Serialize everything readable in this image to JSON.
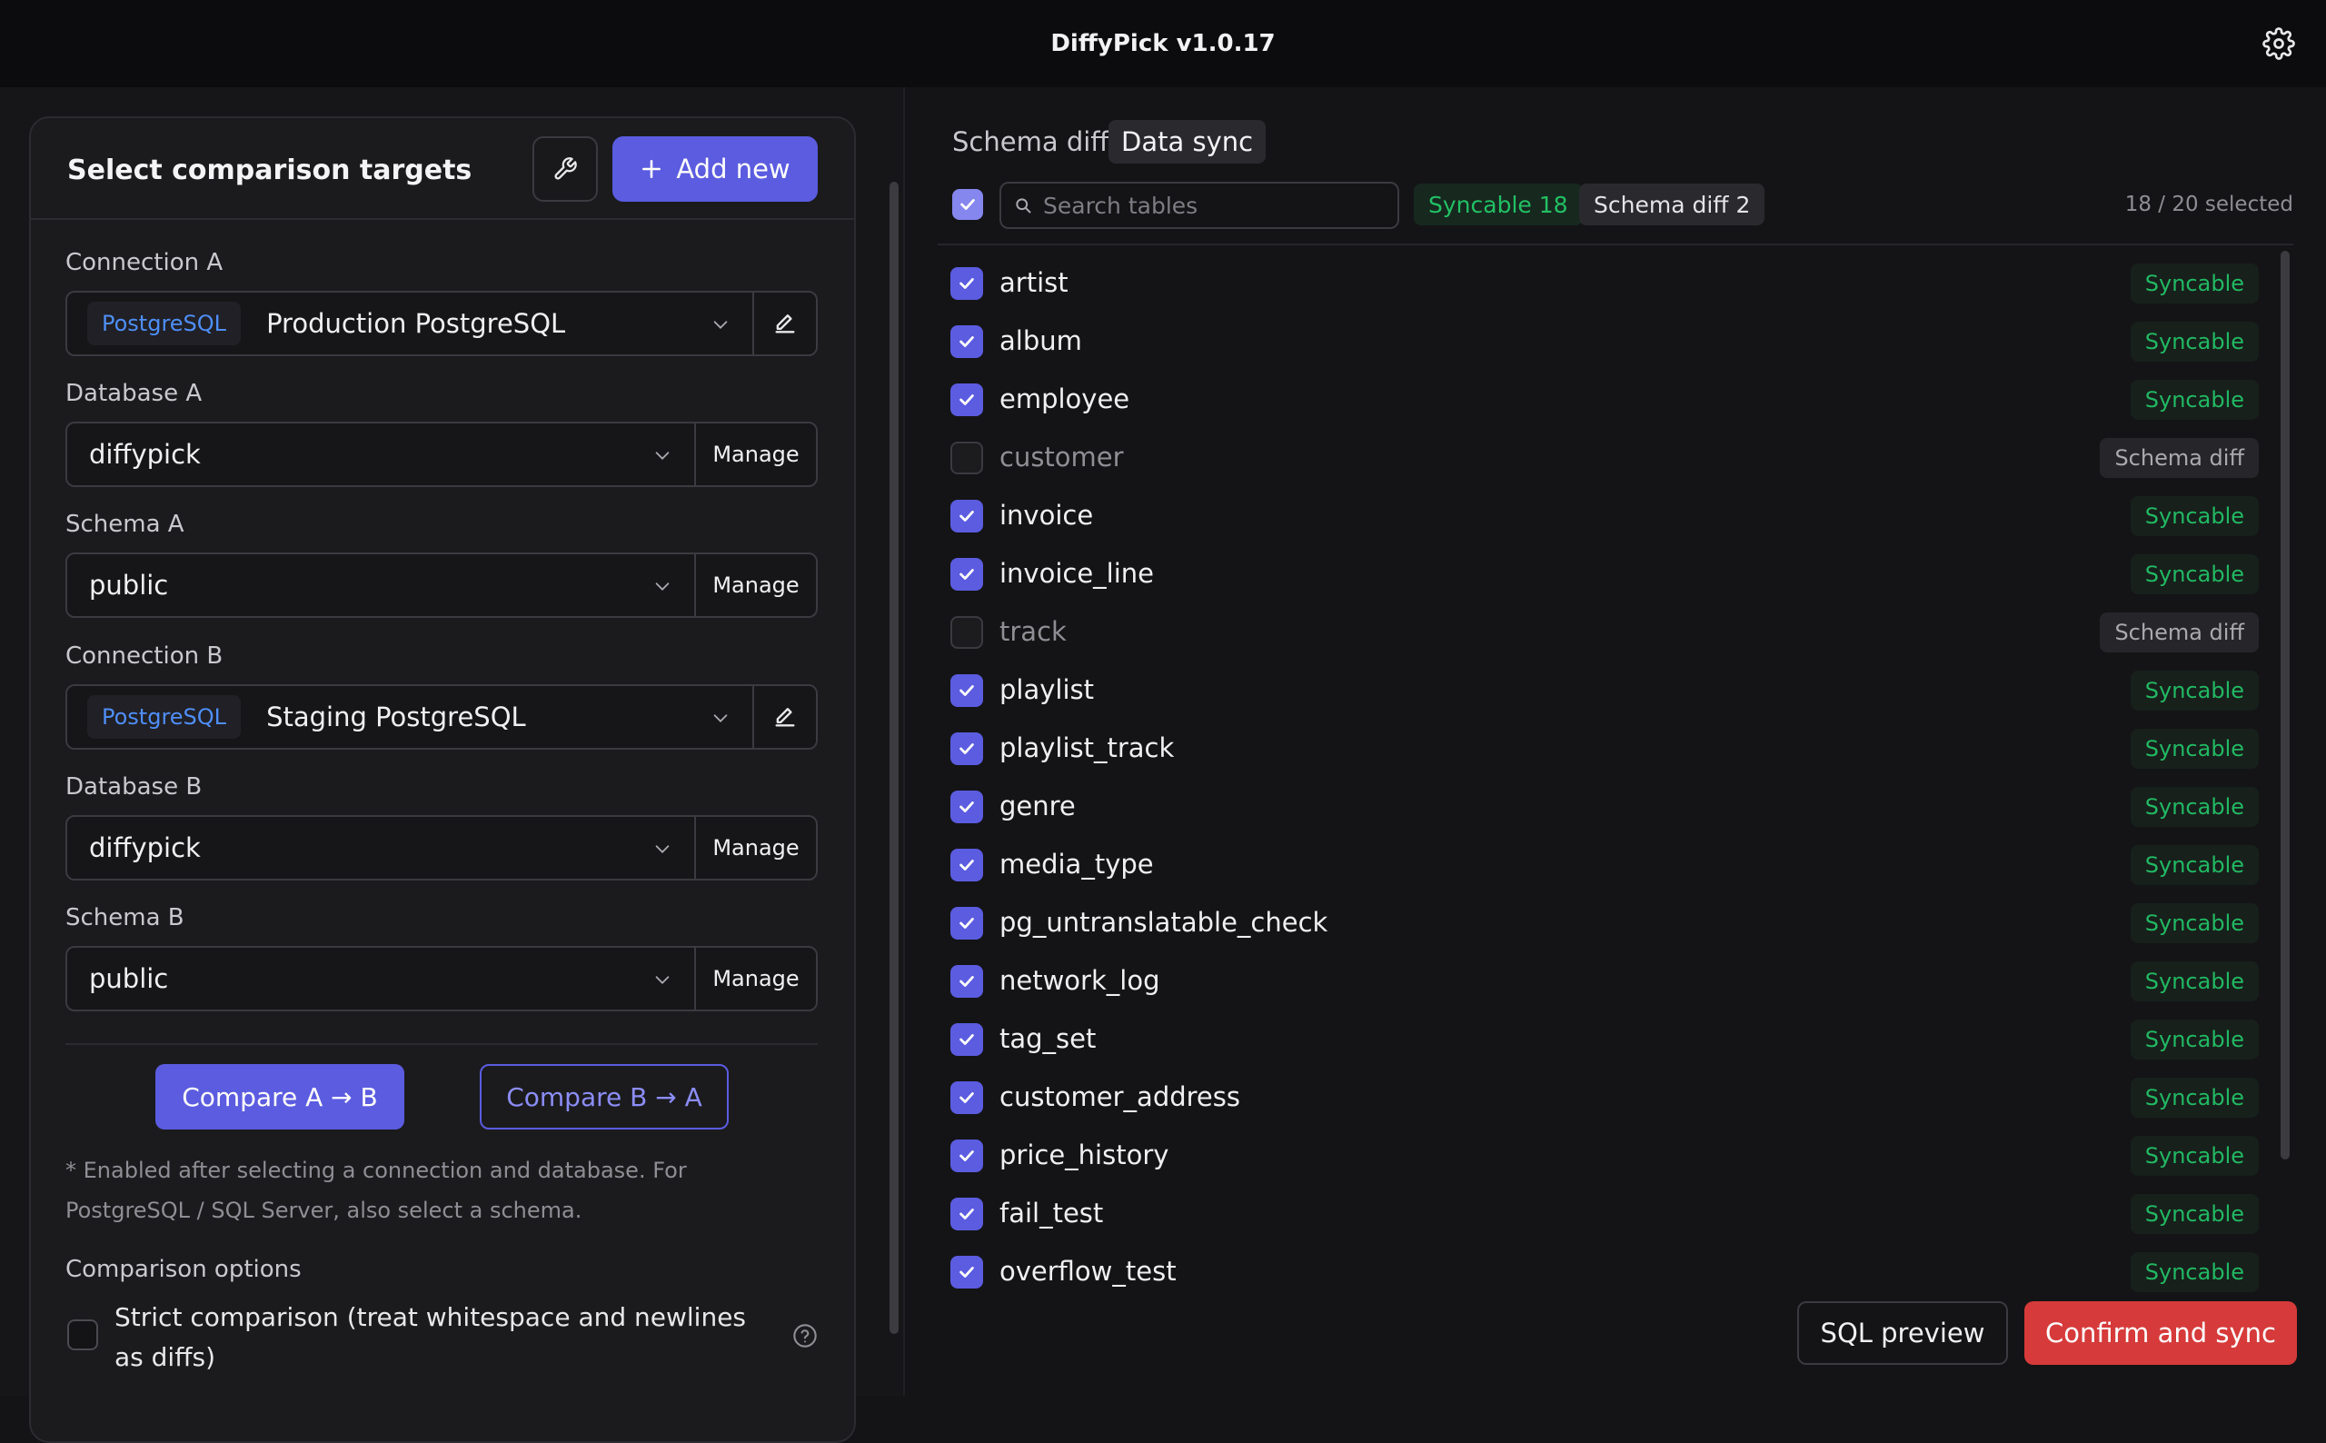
{
  "app": {
    "title": "DiffyPick v1.0.17"
  },
  "left": {
    "title": "Select comparison targets",
    "add_new_label": "Add new",
    "connection_a": {
      "label": "Connection A",
      "badge": "PostgreSQL",
      "value": "Production PostgreSQL"
    },
    "database_a": {
      "label": "Database A",
      "value": "diffypick",
      "manage": "Manage"
    },
    "schema_a": {
      "label": "Schema A",
      "value": "public",
      "manage": "Manage"
    },
    "connection_b": {
      "label": "Connection B",
      "badge": "PostgreSQL",
      "value": "Staging PostgreSQL"
    },
    "database_b": {
      "label": "Database B",
      "value": "diffypick",
      "manage": "Manage"
    },
    "schema_b": {
      "label": "Schema B",
      "value": "public",
      "manage": "Manage"
    },
    "compare_ab": "Compare A → B",
    "compare_ba": "Compare B → A",
    "note": "* Enabled after selecting a connection and database. For PostgreSQL / SQL Server, also select a schema.",
    "options_title": "Comparison options",
    "strict_label": "Strict comparison (treat whitespace and newlines as diffs)"
  },
  "right": {
    "tabs": [
      {
        "label": "Schema diff"
      },
      {
        "label": "Data sync"
      }
    ],
    "search_placeholder": "Search tables",
    "chip_syncable": "Syncable 18",
    "chip_schema_diff": "Schema diff 2",
    "selected_count": "18 / 20 selected",
    "sql_preview": "SQL preview",
    "confirm": "Confirm and sync",
    "tables": [
      {
        "name": "artist",
        "checked": true,
        "status": "Syncable"
      },
      {
        "name": "album",
        "checked": true,
        "status": "Syncable"
      },
      {
        "name": "employee",
        "checked": true,
        "status": "Syncable"
      },
      {
        "name": "customer",
        "checked": false,
        "status": "Schema diff"
      },
      {
        "name": "invoice",
        "checked": true,
        "status": "Syncable"
      },
      {
        "name": "invoice_line",
        "checked": true,
        "status": "Syncable"
      },
      {
        "name": "track",
        "checked": false,
        "status": "Schema diff"
      },
      {
        "name": "playlist",
        "checked": true,
        "status": "Syncable"
      },
      {
        "name": "playlist_track",
        "checked": true,
        "status": "Syncable"
      },
      {
        "name": "genre",
        "checked": true,
        "status": "Syncable"
      },
      {
        "name": "media_type",
        "checked": true,
        "status": "Syncable"
      },
      {
        "name": "pg_untranslatable_check",
        "checked": true,
        "status": "Syncable"
      },
      {
        "name": "network_log",
        "checked": true,
        "status": "Syncable"
      },
      {
        "name": "tag_set",
        "checked": true,
        "status": "Syncable"
      },
      {
        "name": "customer_address",
        "checked": true,
        "status": "Syncable"
      },
      {
        "name": "price_history",
        "checked": true,
        "status": "Syncable"
      },
      {
        "name": "fail_test",
        "checked": true,
        "status": "Syncable"
      },
      {
        "name": "overflow_test",
        "checked": true,
        "status": "Syncable"
      }
    ]
  }
}
